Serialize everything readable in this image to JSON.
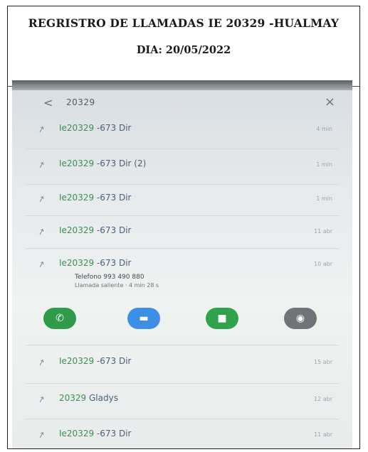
{
  "header": {
    "title": "REGRISTRO DE LLAMADAS IE 20329 -HUALMAY",
    "date": "DIA: 20/05/2022"
  },
  "phone": {
    "search_query": "20329",
    "calls": [
      {
        "contact_digits": "Ie20329",
        "contact_rest": " -673 Dir",
        "count": "",
        "when": "4 min"
      },
      {
        "contact_digits": "Ie20329",
        "contact_rest": " -673 Dir (2)",
        "count": "",
        "when": "1 min"
      },
      {
        "contact_digits": "Ie20329",
        "contact_rest": " -673 Dir",
        "count": "",
        "when": "1 min"
      },
      {
        "contact_digits": "Ie20329",
        "contact_rest": " -673 Dir",
        "count": "",
        "when": "11 abr"
      },
      {
        "contact_digits": "Ie20329",
        "contact_rest": " -673 Dir",
        "count": "",
        "when": "10 abr"
      },
      {
        "contact_digits": "Ie20329",
        "contact_rest": " -673 Dir",
        "count": "",
        "when": "15 abr"
      },
      {
        "contact_digits": "20329",
        "contact_rest": " Gladys",
        "count": "",
        "when": "12 abr"
      },
      {
        "contact_digits": "Ie20329",
        "contact_rest": " -673 Dir",
        "count": "",
        "when": "11 abr"
      }
    ],
    "details": {
      "phone": "Telefono 993 490 880",
      "duration": "Llamada saliente · 4 min 28 s"
    }
  },
  "colors": {
    "call": "#2f9a4a",
    "message": "#3d8fe6",
    "video": "#2fa24a",
    "info": "#6f7479"
  }
}
